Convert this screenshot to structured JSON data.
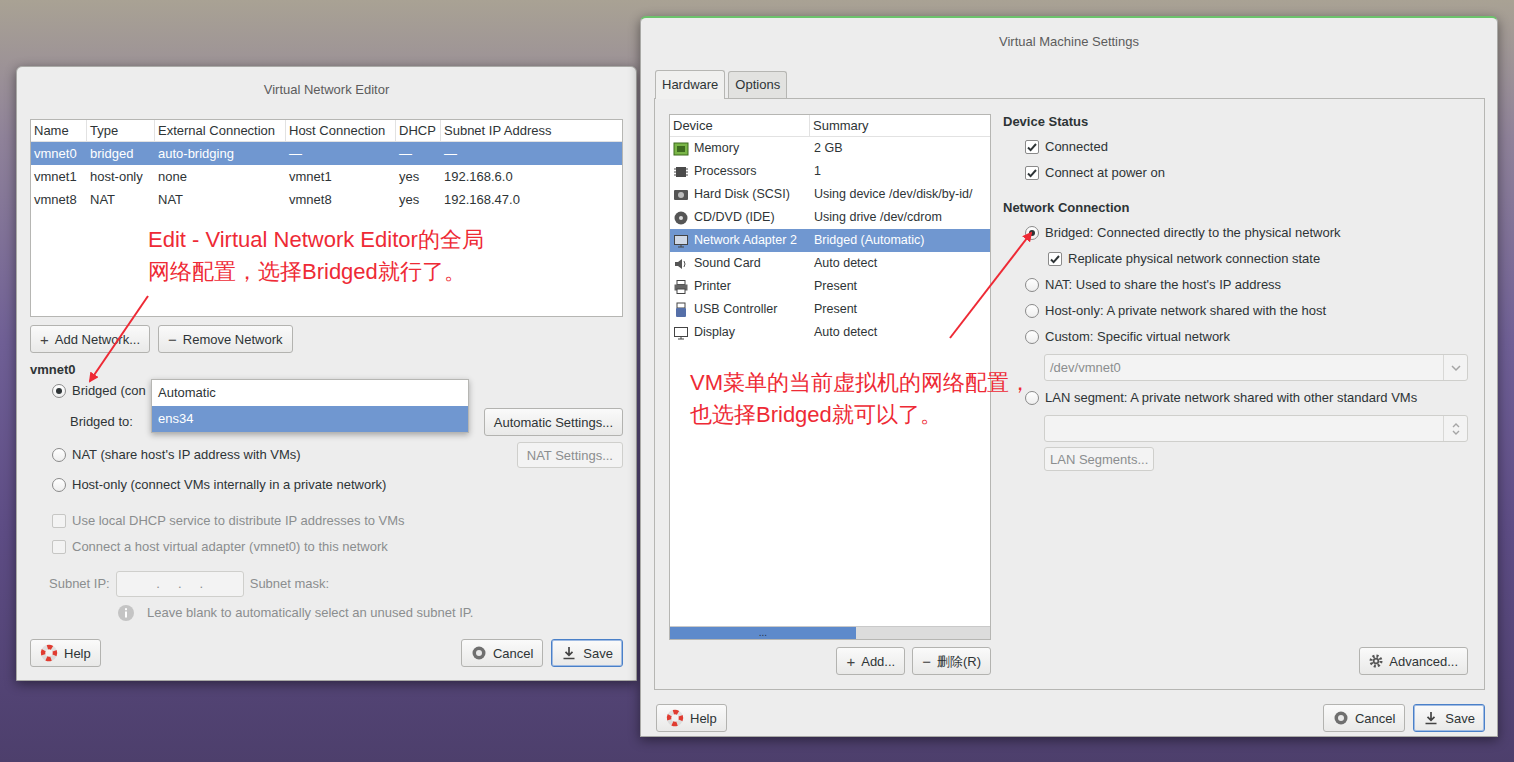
{
  "editor": {
    "title": "Virtual Network Editor",
    "table": {
      "columns": [
        "Name",
        "Type",
        "External Connection",
        "Host Connection",
        "DHCP",
        "Subnet IP Address"
      ],
      "rows": [
        {
          "cells": [
            "vmnet0",
            "bridged",
            "auto-bridging",
            "—",
            "—",
            "—"
          ],
          "selected": true
        },
        {
          "cells": [
            "vmnet1",
            "host-only",
            "none",
            "vmnet1",
            "yes",
            "192.168.6.0"
          ],
          "selected": false
        },
        {
          "cells": [
            "vmnet8",
            "NAT",
            "NAT",
            "vmnet8",
            "yes",
            "192.168.47.0"
          ],
          "selected": false
        }
      ]
    },
    "add_button": {
      "icon": "+",
      "label": "Add Network..."
    },
    "remove_button": {
      "icon": "−",
      "label": "Remove Network"
    },
    "section_title": "vmnet0",
    "bridged": {
      "label": "Bridged (con",
      "selected": true
    },
    "bridged_to": {
      "label": "Bridged to:",
      "expanded": true,
      "options": [
        {
          "label": "Automatic",
          "selected": false
        },
        {
          "label": "ens34",
          "selected": true
        }
      ]
    },
    "automatic_settings": {
      "label": "Automatic Settings...",
      "disabled": false
    },
    "nat": {
      "label": "NAT (share host's IP address with VMs)",
      "selected": false
    },
    "nat_settings": {
      "label": "NAT Settings...",
      "disabled": true
    },
    "host_only": {
      "label": "Host-only (connect VMs internally in a private network)",
      "selected": false
    },
    "checks": [
      {
        "label": "Use local DHCP service to distribute IP addresses to VMs",
        "checked": false,
        "disabled": true
      },
      {
        "label": "Connect a host virtual adapter (vmnet0) to this network",
        "checked": false,
        "disabled": true
      }
    ],
    "subnet": {
      "ip_label": "Subnet IP:",
      "ip_value": ".     .     .",
      "mask_label": "Subnet mask:",
      "disabled": true
    },
    "hint": "Leave blank to automatically select an unused subnet IP.",
    "buttons": [
      {
        "label": "Help",
        "focused": false
      },
      {
        "label": "Cancel",
        "focused": false
      },
      {
        "label": "Save",
        "focused": true
      }
    ]
  },
  "settings": {
    "title": "Virtual Machine Settings",
    "tabs": [
      {
        "label": "Hardware",
        "selected": true
      },
      {
        "label": "Options",
        "selected": false
      }
    ],
    "devices": {
      "columns": [
        "Device",
        "Summary"
      ],
      "rows": [
        {
          "device": "Memory",
          "summary": "2 GB",
          "selected": false
        },
        {
          "device": "Processors",
          "summary": "1",
          "selected": false
        },
        {
          "device": "Hard Disk (SCSI)",
          "summary": "Using device /dev/disk/by-id/",
          "selected": false
        },
        {
          "device": "CD/DVD (IDE)",
          "summary": "Using drive /dev/cdrom",
          "selected": false
        },
        {
          "device": "Network Adapter 2",
          "summary": "Bridged (Automatic)",
          "selected": true
        },
        {
          "device": "Sound Card",
          "summary": "Auto detect",
          "selected": false
        },
        {
          "device": "Printer",
          "summary": "Present",
          "selected": false
        },
        {
          "device": "USB Controller",
          "summary": "Present",
          "selected": false
        },
        {
          "device": "Display",
          "summary": "Auto detect",
          "selected": false
        }
      ],
      "scrollbar": {
        "level": 0.58,
        "grip": "..."
      }
    },
    "add_button": {
      "icon": "+",
      "label": "Add..."
    },
    "remove_button": {
      "icon": "−",
      "label": "删除(R)"
    },
    "device_status": {
      "title": "Device Status",
      "checks": [
        {
          "label": "Connected",
          "checked": true
        },
        {
          "label": "Connect at power on",
          "checked": true
        }
      ]
    },
    "network": {
      "title": "Network Connection",
      "items": [
        {
          "kind": "radio",
          "label": "Bridged: Connected directly to the physical network",
          "selected": true
        },
        {
          "kind": "check",
          "label": "Replicate physical network connection state",
          "checked": true
        },
        {
          "kind": "radio",
          "label": "NAT: Used to share the host's IP address",
          "selected": false
        },
        {
          "kind": "radio",
          "label": "Host-only: A private network shared with the host",
          "selected": false
        },
        {
          "kind": "radio",
          "label": "Custom: Specific virtual network",
          "selected": false
        },
        {
          "kind": "select",
          "value": "/dev/vmnet0",
          "disabled": true
        },
        {
          "kind": "radio",
          "label": "LAN segment: A private network shared with other standard VMs",
          "selected": false
        },
        {
          "kind": "select",
          "value": "",
          "disabled": true
        },
        {
          "kind": "button",
          "label": "LAN Segments...",
          "disabled": true
        }
      ]
    },
    "advanced_button": {
      "label": "Advanced..."
    },
    "buttons": [
      {
        "label": "Help",
        "focused": false
      },
      {
        "label": "Cancel",
        "focused": false
      },
      {
        "label": "Save",
        "focused": true
      }
    ]
  },
  "annotations": [
    {
      "lines": [
        "Edit - Virtual Network Editor的全局",
        "网络配置，选择Bridged就行了。"
      ]
    },
    {
      "lines": [
        "VM菜单的当前虚拟机的网络配置，",
        "也选择Bridged就可以了。"
      ]
    }
  ]
}
